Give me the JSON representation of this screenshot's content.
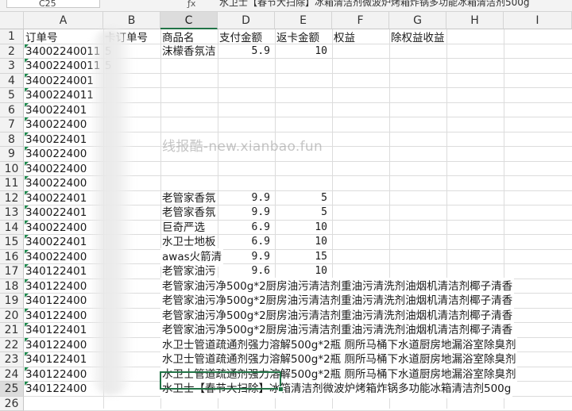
{
  "toolbar": {
    "namebox": "C25",
    "fx_icon": "function-icon",
    "formula_text": "水卫士【春节大扫除】冰箱清洁剂微波炉烤箱炸锅多功能冰箱清洁剂500g"
  },
  "watermark": "线报酷-new.xianbao.fun",
  "columns": [
    "A",
    "B",
    "C",
    "D",
    "E",
    "F",
    "G",
    "H",
    "I"
  ],
  "selected_column": "C",
  "rows": [
    "1",
    "2",
    "3",
    "4",
    "5",
    "6",
    "7",
    "8",
    "9",
    "10",
    "11",
    "12",
    "13",
    "14",
    "15",
    "16",
    "17",
    "18",
    "19",
    "20",
    "21",
    "22",
    "23",
    "24",
    "25",
    "26"
  ],
  "selected_row": "25",
  "headers": {
    "a": "订单号",
    "b": "卡订单号",
    "c": "商品名",
    "d": "支付金额",
    "e": "返卡金额",
    "f": "权益",
    "g": "除权益收益"
  },
  "cells": {
    "a2": "34002240011",
    "b2": "5",
    "c2": "沫檬香氛洁",
    "d2": "5.9",
    "e2": "10",
    "a3": "34002240011",
    "b3": "5",
    "a4": "3400224001",
    "a5": "3400224011",
    "a6": "340022401",
    "a7": "340022400",
    "a8": "340022401",
    "a9": "340022400",
    "a10": "340022400",
    "a11": "340022400",
    "a12": "340022401",
    "c12": "老管家香氛",
    "d12": "9.9",
    "e12": "5",
    "a13": "340022401",
    "c13": "老管家香氛",
    "d13": "9.9",
    "e13": "5",
    "a14": "340022400",
    "c14": "巨奇严选",
    "d14": "6.9",
    "e14": "10",
    "a15": "340022401",
    "c15": "水卫士地板",
    "d15": "6.9",
    "e15": "10",
    "a16": "340022400",
    "c16": "awas火箭清",
    "d16": "9.9",
    "e16": "15",
    "a17": "340122401",
    "c17": "老管家油污",
    "d17": "9.6",
    "e17": "10",
    "a18": "340122400",
    "c18": "老管家油污净500g*2厨房油污清洁剂重油污清洗剂油烟机清洁剂椰子清香",
    "a19": "340122400",
    "c19": "老管家油污净500g*2厨房油污清洁剂重油污清洗剂油烟机清洁剂椰子清香",
    "a20": "340122400",
    "c20": "老管家油污净500g*2厨房油污清洁剂重油污清洗剂油烟机清洁剂椰子清香",
    "a21": "340122401",
    "c21": "老管家油污净500g*2厨房油污清洁剂重油污清洗剂油烟机清洁剂椰子清香",
    "a22": "340122400",
    "c22": "水卫士管道疏通剂强力溶解500g*2瓶  厕所马桶下水道厨房地漏浴室除臭剂",
    "a23": "340122401",
    "c23": "水卫士管道疏通剂强力溶解500g*2瓶  厕所马桶下水道厨房地漏浴室除臭剂",
    "a24": "340122400",
    "c24": "水卫士管道疏通剂强力溶解500g*2瓶  厕所马桶下水道厨房地漏浴室除臭剂",
    "a25": "340122400",
    "c25": "水卫士【春节大扫除】冰箱清洁剂微波炉烤箱炸锅多功能冰箱清洁剂500g"
  },
  "colors": {
    "accent_green": "#217346",
    "header_bg": "#f2f2f2",
    "gridline": "#dcdcdc"
  }
}
